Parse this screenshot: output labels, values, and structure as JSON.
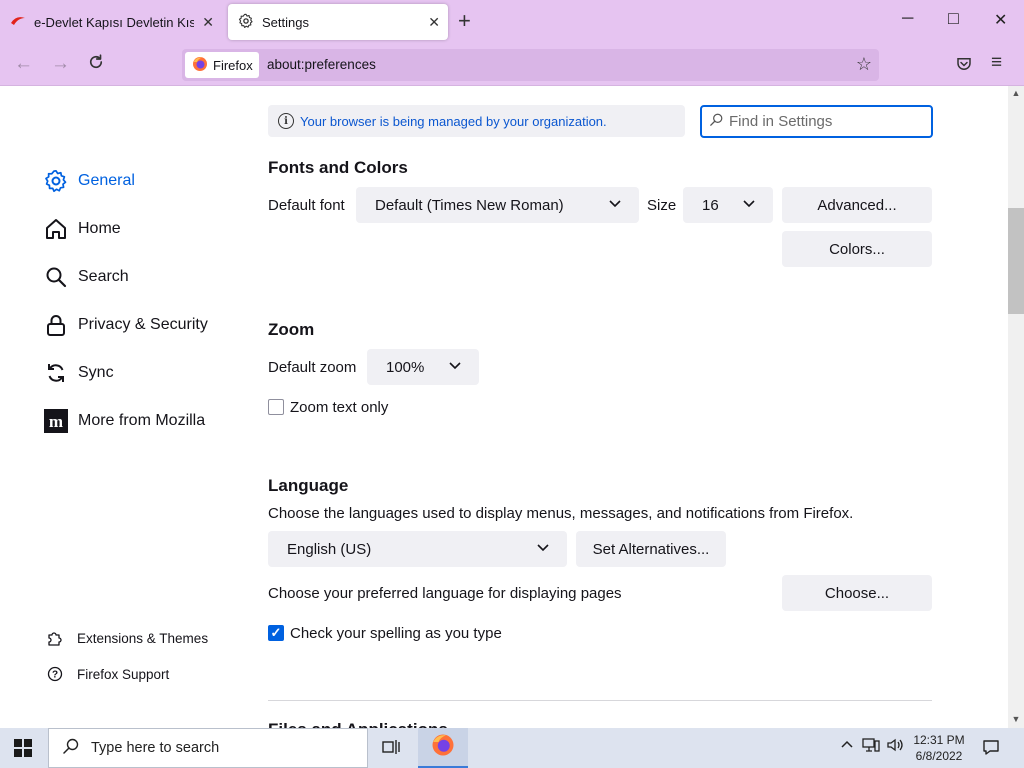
{
  "window": {
    "tabs": [
      {
        "title": "e-Devlet Kapısı Devletin Kısayol",
        "icon": "edevlet-icon",
        "active": false
      },
      {
        "title": "Settings",
        "icon": "gear-icon",
        "active": true
      }
    ],
    "controls": {
      "minimize": "─",
      "maximize": "□",
      "close": "✕"
    }
  },
  "navbar": {
    "identity_label": "Firefox",
    "url": "about:preferences"
  },
  "sidebar": {
    "categories": [
      {
        "label": "General",
        "icon": "gear-icon",
        "selected": true
      },
      {
        "label": "Home",
        "icon": "home-icon"
      },
      {
        "label": "Search",
        "icon": "search-icon"
      },
      {
        "label": "Privacy & Security",
        "icon": "lock-icon"
      },
      {
        "label": "Sync",
        "icon": "sync-icon"
      },
      {
        "label": "More from Mozilla",
        "icon": "mozilla-icon"
      }
    ],
    "footer": [
      {
        "label": "Extensions & Themes",
        "icon": "puzzle-icon"
      },
      {
        "label": "Firefox Support",
        "icon": "help-icon"
      }
    ]
  },
  "main": {
    "policies_notice": "Your browser is being managed by your organization.",
    "search_placeholder": "Find in Settings",
    "fonts": {
      "heading": "Fonts and Colors",
      "default_font_label": "Default font",
      "default_font_value": "Default (Times New Roman)",
      "size_label": "Size",
      "size_value": "16",
      "advanced_button": "Advanced...",
      "colors_button": "Colors..."
    },
    "zoom": {
      "heading": "Zoom",
      "default_zoom_label": "Default zoom",
      "default_zoom_value": "100%",
      "zoom_text_only_label": "Zoom text only",
      "zoom_text_only_checked": false
    },
    "language": {
      "heading": "Language",
      "description": "Choose the languages used to display menus, messages, and notifications from Firefox.",
      "language_value": "English (US)",
      "set_alternatives_button": "Set Alternatives...",
      "preferred_pages_label": "Choose your preferred language for displaying pages",
      "choose_button": "Choose...",
      "spellcheck_label": "Check your spelling as you type",
      "spellcheck_checked": true
    },
    "next_heading_partial": "Files and Applications"
  },
  "taskbar": {
    "search_placeholder": "Type here to search",
    "time": "12:31 PM",
    "date": "6/8/2022"
  },
  "colors": {
    "accent": "#0061e0",
    "tabbar": "#e6c4f1",
    "taskbar": "#dde3ef"
  }
}
